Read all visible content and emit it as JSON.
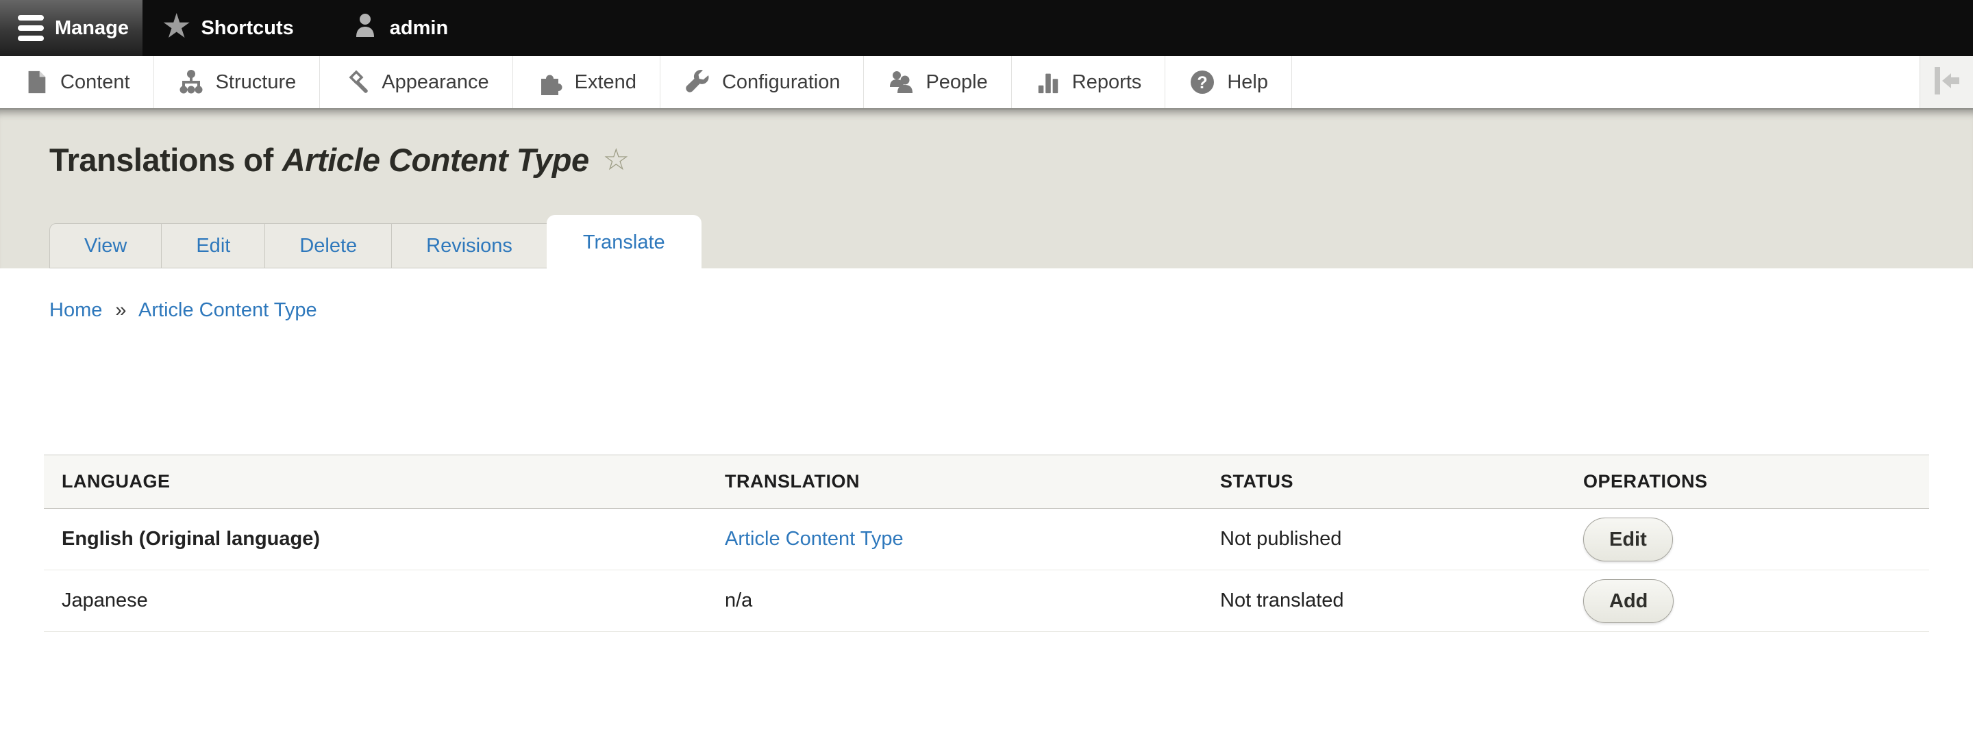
{
  "admin_bar": {
    "manage": {
      "label": "Manage"
    },
    "shortcuts": {
      "label": "Shortcuts",
      "star_glyph": "★"
    },
    "user": {
      "label": "admin"
    }
  },
  "toolbar": {
    "items": [
      {
        "label": "Content"
      },
      {
        "label": "Structure"
      },
      {
        "label": "Appearance"
      },
      {
        "label": "Extend"
      },
      {
        "label": "Configuration"
      },
      {
        "label": "People"
      },
      {
        "label": "Reports"
      },
      {
        "label": "Help"
      }
    ]
  },
  "page": {
    "title_prefix": "Translations of",
    "title_entity": "Article Content Type",
    "favorite_star_glyph": "☆",
    "tabs": [
      {
        "label": "View"
      },
      {
        "label": "Edit"
      },
      {
        "label": "Delete"
      },
      {
        "label": "Revisions"
      },
      {
        "label": "Translate"
      }
    ],
    "active_tab": "Translate",
    "breadcrumb": {
      "home": "Home",
      "separator": "»",
      "current": "Article Content Type"
    }
  },
  "table": {
    "headers": {
      "language": "LANGUAGE",
      "translation": "TRANSLATION",
      "status": "STATUS",
      "operations": "OPERATIONS"
    },
    "rows": [
      {
        "language": "English (Original language)",
        "translation": "Article Content Type",
        "status": "Not published",
        "operation": "Edit"
      },
      {
        "language": "Japanese",
        "translation": "n/a",
        "status": "Not translated",
        "operation": "Add"
      }
    ]
  },
  "colors": {
    "link_blue": "#2e78bc",
    "admin_bar_bg": "#0d0d0d",
    "page_header_bg": "#e3e2da",
    "toolbar_icon_gray": "#7a7a7a",
    "table_header_bg": "#f7f7f4"
  }
}
